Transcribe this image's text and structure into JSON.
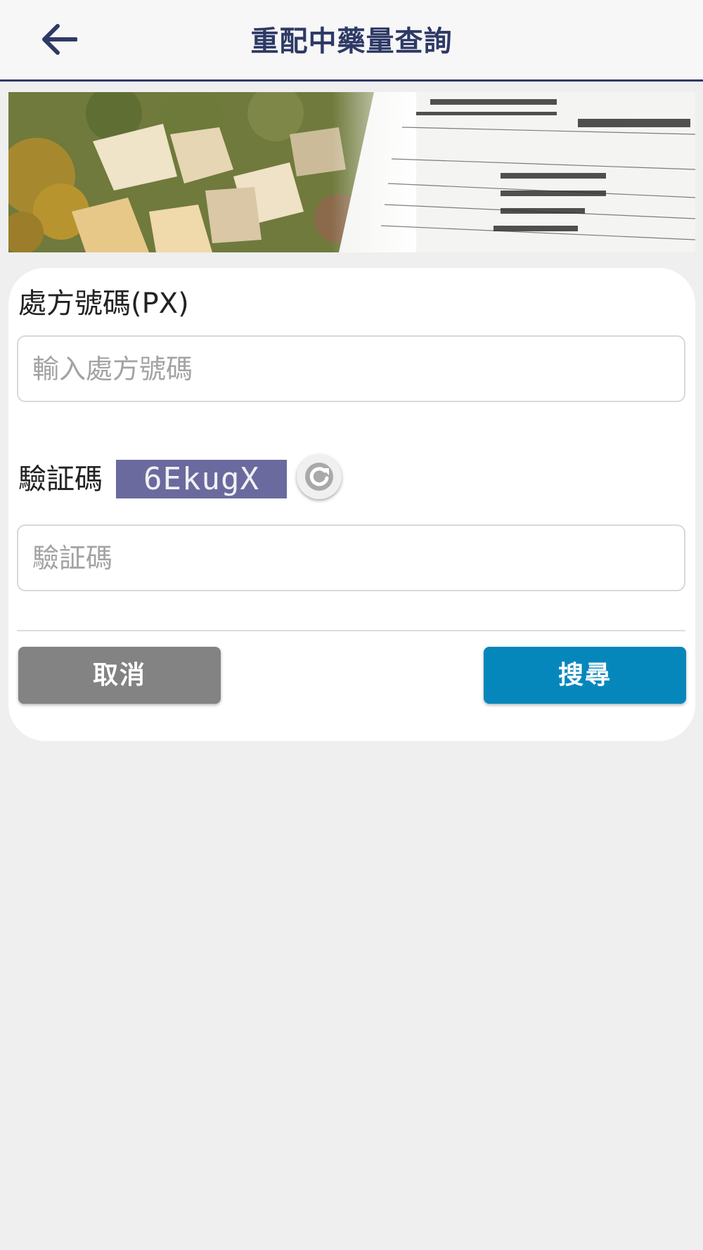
{
  "header": {
    "title": "重配中藥量查詢",
    "back_icon": "arrow-left-icon"
  },
  "form": {
    "prescription_label": "處方號碼(PX)",
    "prescription_placeholder": "輸入處方號碼",
    "prescription_value": "",
    "captcha_label": "驗証碼",
    "captcha_text": "6EkugX",
    "refresh_icon": "refresh-icon",
    "captcha_placeholder": "驗証碼",
    "captcha_value": ""
  },
  "actions": {
    "cancel_label": "取消",
    "search_label": "搜尋"
  },
  "colors": {
    "header_text": "#2e3a66",
    "search_button": "#0687bc",
    "cancel_button": "#838383",
    "captcha_bg": "#6b6a9e"
  }
}
